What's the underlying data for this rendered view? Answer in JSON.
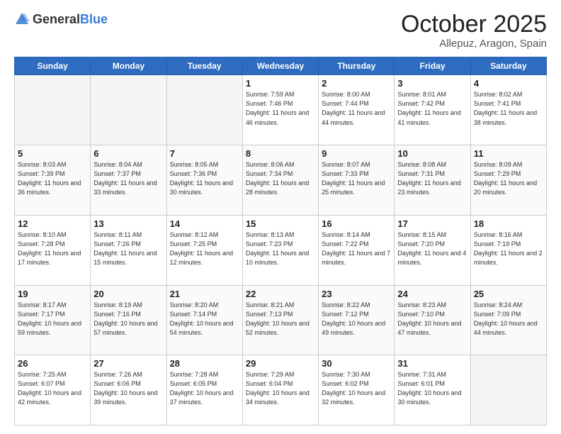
{
  "header": {
    "logo_general": "General",
    "logo_blue": "Blue",
    "month_title": "October 2025",
    "subtitle": "Allepuz, Aragon, Spain"
  },
  "days_of_week": [
    "Sunday",
    "Monday",
    "Tuesday",
    "Wednesday",
    "Thursday",
    "Friday",
    "Saturday"
  ],
  "weeks": [
    [
      {
        "day": "",
        "info": ""
      },
      {
        "day": "",
        "info": ""
      },
      {
        "day": "",
        "info": ""
      },
      {
        "day": "1",
        "info": "Sunrise: 7:59 AM\nSunset: 7:46 PM\nDaylight: 11 hours and 46 minutes."
      },
      {
        "day": "2",
        "info": "Sunrise: 8:00 AM\nSunset: 7:44 PM\nDaylight: 11 hours and 44 minutes."
      },
      {
        "day": "3",
        "info": "Sunrise: 8:01 AM\nSunset: 7:42 PM\nDaylight: 11 hours and 41 minutes."
      },
      {
        "day": "4",
        "info": "Sunrise: 8:02 AM\nSunset: 7:41 PM\nDaylight: 11 hours and 38 minutes."
      }
    ],
    [
      {
        "day": "5",
        "info": "Sunrise: 8:03 AM\nSunset: 7:39 PM\nDaylight: 11 hours and 36 minutes."
      },
      {
        "day": "6",
        "info": "Sunrise: 8:04 AM\nSunset: 7:37 PM\nDaylight: 11 hours and 33 minutes."
      },
      {
        "day": "7",
        "info": "Sunrise: 8:05 AM\nSunset: 7:36 PM\nDaylight: 11 hours and 30 minutes."
      },
      {
        "day": "8",
        "info": "Sunrise: 8:06 AM\nSunset: 7:34 PM\nDaylight: 11 hours and 28 minutes."
      },
      {
        "day": "9",
        "info": "Sunrise: 8:07 AM\nSunset: 7:33 PM\nDaylight: 11 hours and 25 minutes."
      },
      {
        "day": "10",
        "info": "Sunrise: 8:08 AM\nSunset: 7:31 PM\nDaylight: 11 hours and 23 minutes."
      },
      {
        "day": "11",
        "info": "Sunrise: 8:09 AM\nSunset: 7:29 PM\nDaylight: 11 hours and 20 minutes."
      }
    ],
    [
      {
        "day": "12",
        "info": "Sunrise: 8:10 AM\nSunset: 7:28 PM\nDaylight: 11 hours and 17 minutes."
      },
      {
        "day": "13",
        "info": "Sunrise: 8:11 AM\nSunset: 7:26 PM\nDaylight: 11 hours and 15 minutes."
      },
      {
        "day": "14",
        "info": "Sunrise: 8:12 AM\nSunset: 7:25 PM\nDaylight: 11 hours and 12 minutes."
      },
      {
        "day": "15",
        "info": "Sunrise: 8:13 AM\nSunset: 7:23 PM\nDaylight: 11 hours and 10 minutes."
      },
      {
        "day": "16",
        "info": "Sunrise: 8:14 AM\nSunset: 7:22 PM\nDaylight: 11 hours and 7 minutes."
      },
      {
        "day": "17",
        "info": "Sunrise: 8:15 AM\nSunset: 7:20 PM\nDaylight: 11 hours and 4 minutes."
      },
      {
        "day": "18",
        "info": "Sunrise: 8:16 AM\nSunset: 7:19 PM\nDaylight: 11 hours and 2 minutes."
      }
    ],
    [
      {
        "day": "19",
        "info": "Sunrise: 8:17 AM\nSunset: 7:17 PM\nDaylight: 10 hours and 59 minutes."
      },
      {
        "day": "20",
        "info": "Sunrise: 8:19 AM\nSunset: 7:16 PM\nDaylight: 10 hours and 57 minutes."
      },
      {
        "day": "21",
        "info": "Sunrise: 8:20 AM\nSunset: 7:14 PM\nDaylight: 10 hours and 54 minutes."
      },
      {
        "day": "22",
        "info": "Sunrise: 8:21 AM\nSunset: 7:13 PM\nDaylight: 10 hours and 52 minutes."
      },
      {
        "day": "23",
        "info": "Sunrise: 8:22 AM\nSunset: 7:12 PM\nDaylight: 10 hours and 49 minutes."
      },
      {
        "day": "24",
        "info": "Sunrise: 8:23 AM\nSunset: 7:10 PM\nDaylight: 10 hours and 47 minutes."
      },
      {
        "day": "25",
        "info": "Sunrise: 8:24 AM\nSunset: 7:09 PM\nDaylight: 10 hours and 44 minutes."
      }
    ],
    [
      {
        "day": "26",
        "info": "Sunrise: 7:25 AM\nSunset: 6:07 PM\nDaylight: 10 hours and 42 minutes."
      },
      {
        "day": "27",
        "info": "Sunrise: 7:26 AM\nSunset: 6:06 PM\nDaylight: 10 hours and 39 minutes."
      },
      {
        "day": "28",
        "info": "Sunrise: 7:28 AM\nSunset: 6:05 PM\nDaylight: 10 hours and 37 minutes."
      },
      {
        "day": "29",
        "info": "Sunrise: 7:29 AM\nSunset: 6:04 PM\nDaylight: 10 hours and 34 minutes."
      },
      {
        "day": "30",
        "info": "Sunrise: 7:30 AM\nSunset: 6:02 PM\nDaylight: 10 hours and 32 minutes."
      },
      {
        "day": "31",
        "info": "Sunrise: 7:31 AM\nSunset: 6:01 PM\nDaylight: 10 hours and 30 minutes."
      },
      {
        "day": "",
        "info": ""
      }
    ]
  ]
}
